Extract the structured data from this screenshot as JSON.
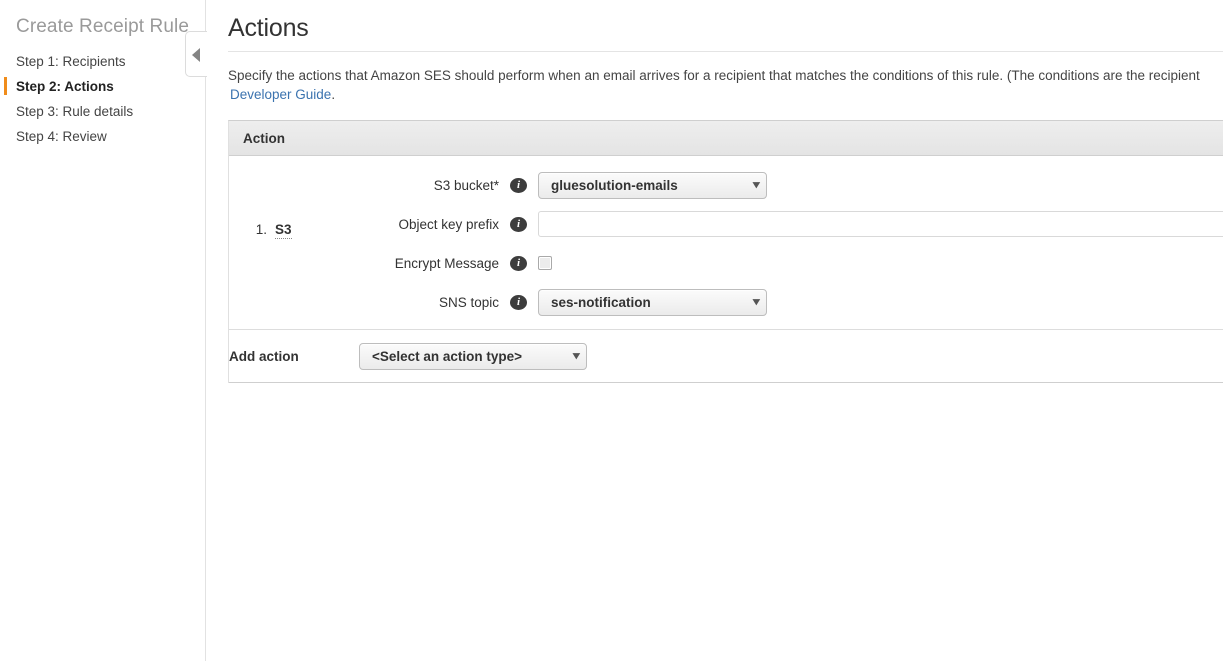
{
  "sidebar": {
    "title": "Create Receipt Rule",
    "steps": [
      {
        "label": "Step 1: Recipients",
        "current": false
      },
      {
        "label": "Step 2: Actions",
        "current": true
      },
      {
        "label": "Step 3: Rule details",
        "current": false
      },
      {
        "label": "Step 4: Review",
        "current": false
      }
    ]
  },
  "collapse_handle": {
    "icon": "chevron-left-icon",
    "glyph": "◀"
  },
  "main": {
    "page_title": "Actions",
    "intro_line1": "Specify the actions that Amazon SES should perform when an email arrives for a recipient that matches the conditions of this rule. (The conditions are the recipient",
    "intro_link": "Developer Guide",
    "intro_after_link": ".",
    "table_header": "Action",
    "add_action_label": "Add action",
    "add_action_select": "<Select an action type>"
  },
  "actions": [
    {
      "index": "1.",
      "type": "S3",
      "fields": [
        {
          "label": "S3 bucket*",
          "control": "select",
          "value": "gluesolution-emails",
          "info": "info-icon"
        },
        {
          "label": "Object key prefix",
          "control": "text",
          "value": "",
          "placeholder": "",
          "info": "info-icon"
        },
        {
          "label": "Encrypt Message",
          "control": "checkbox",
          "checked": false,
          "info": "info-icon"
        },
        {
          "label": "SNS topic",
          "control": "select",
          "value": "ses-notification",
          "info": "info-icon"
        }
      ]
    }
  ],
  "icons": {
    "chevron_down": "▾",
    "info": "i"
  },
  "colors": {
    "accent_orange": "#f08c1b",
    "link_blue": "#3b73af",
    "text_dark": "#333333",
    "muted_gray": "#9a9a9a",
    "border_gray": "#cfcfcf"
  }
}
